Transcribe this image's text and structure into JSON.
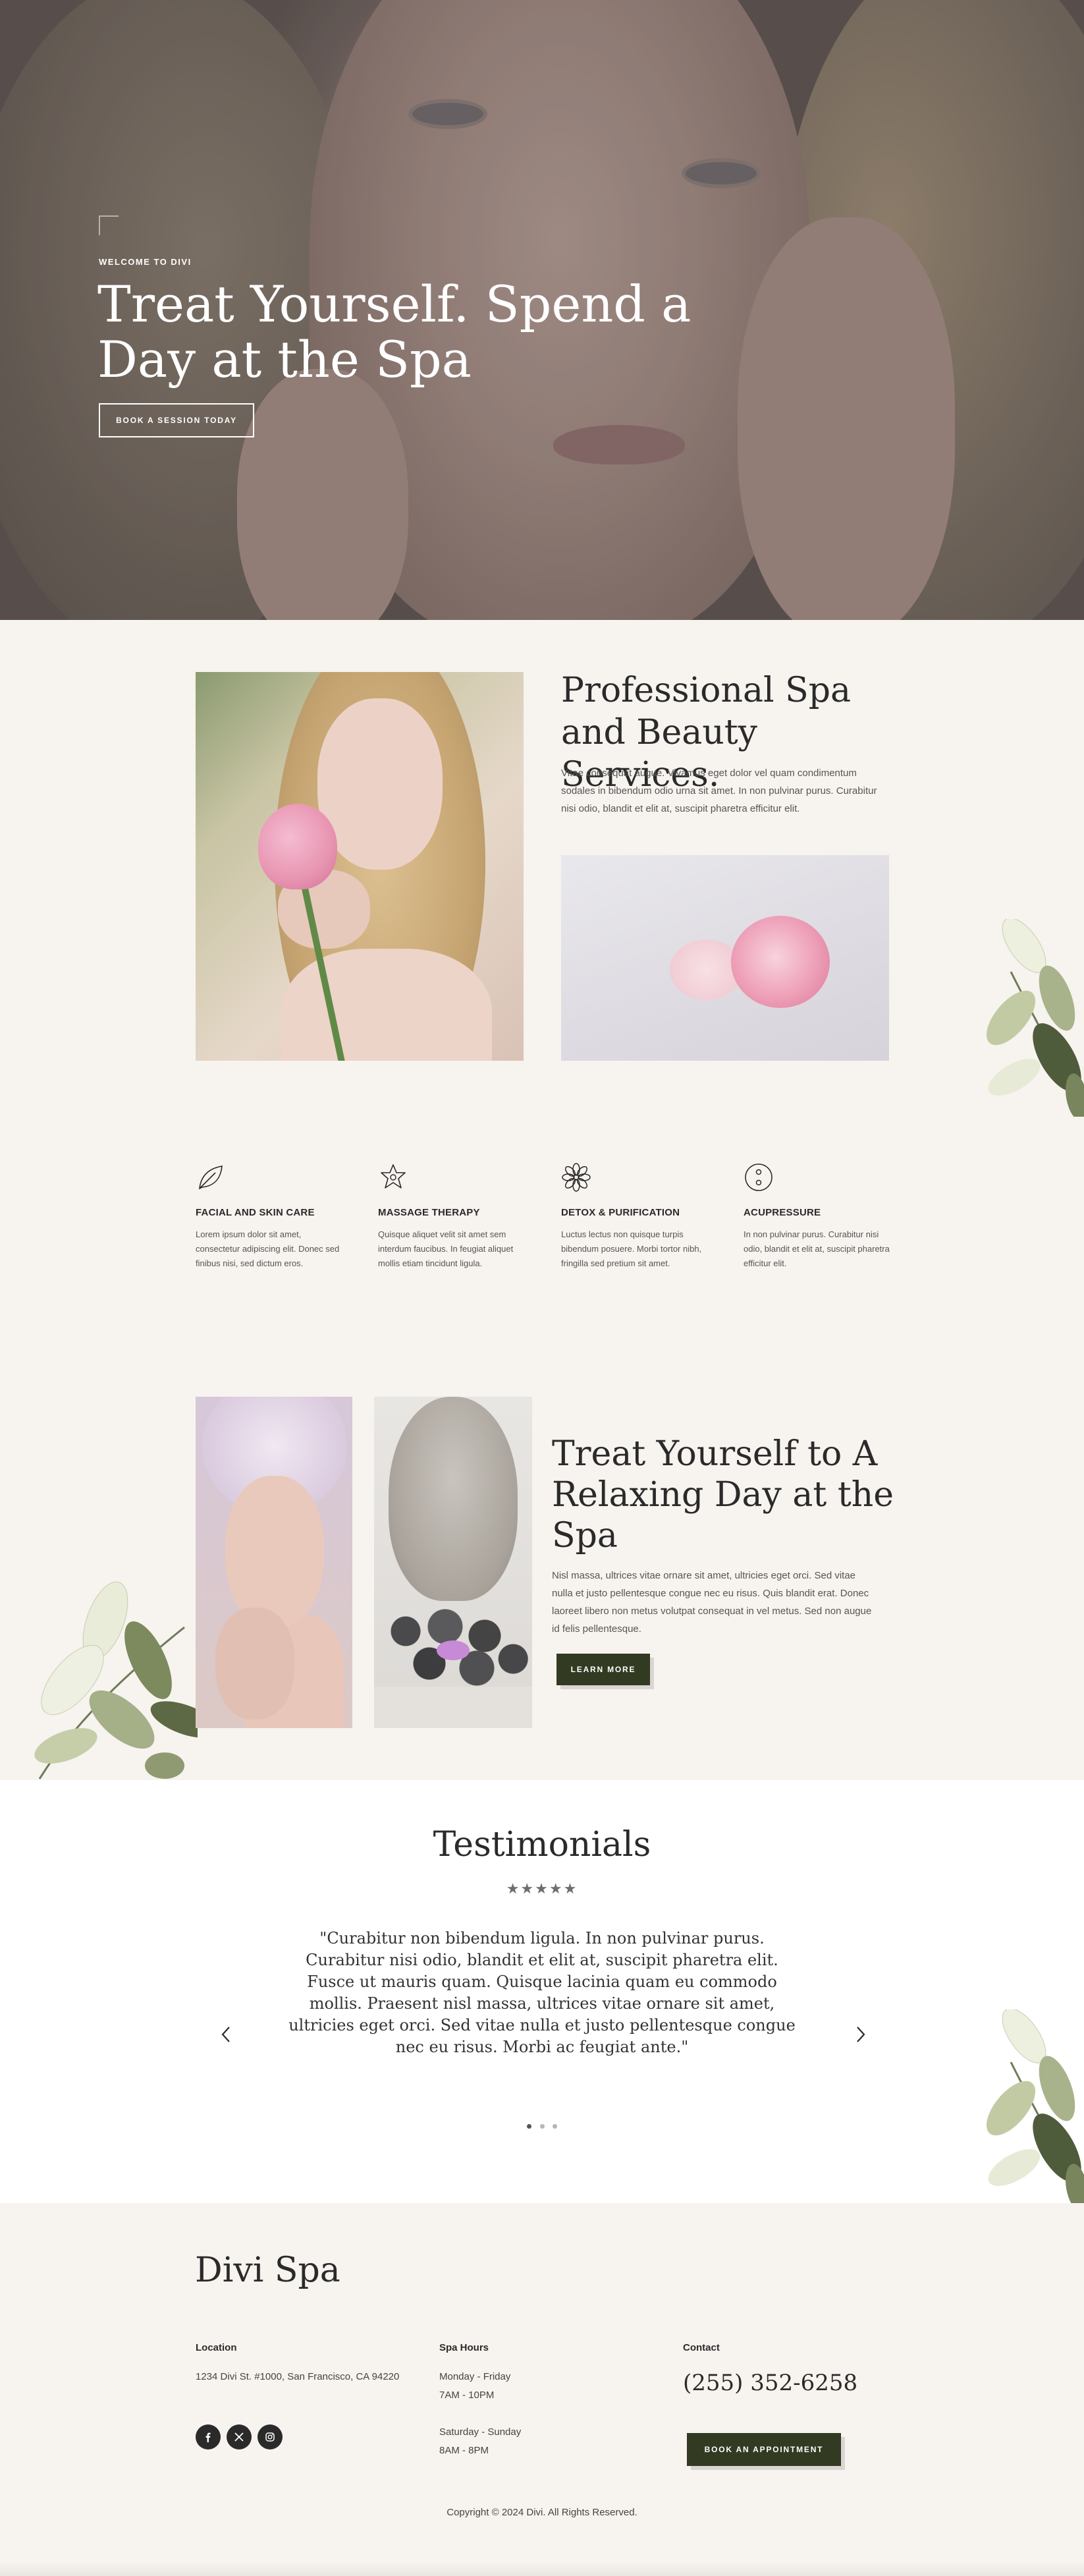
{
  "hero": {
    "kicker": "WELCOME TO DIVI",
    "title": "Treat Yourself. Spend a Day at the Spa",
    "button": "BOOK A SESSION TODAY"
  },
  "about": {
    "title": "Professional Spa and Beauty Services.",
    "text": "Vitae consequat augue. Vivamus eget dolor vel quam condimentum sodales in bibendum odio urna sit amet. In non pulvinar purus. Curabitur nisi odio, blandit et elit at, suscipit pharetra efficitur elit."
  },
  "services": [
    {
      "icon": "leaf-icon",
      "title": "FACIAL AND SKIN CARE",
      "text": "Lorem ipsum dolor sit amet, consectetur adipiscing elit. Donec sed finibus nisi, sed dictum eros."
    },
    {
      "icon": "star-icon",
      "title": "MASSAGE THERAPY",
      "text": "Quisque aliquet velit sit amet sem interdum faucibus. In feugiat aliquet mollis etiam tincidunt ligula."
    },
    {
      "icon": "flower-icon",
      "title": "DETOX & PURIFICATION",
      "text": "Luctus lectus non quisque turpis bibendum posuere. Morbi tortor nibh, fringilla sed pretium sit amet."
    },
    {
      "icon": "acupressure-icon",
      "title": "ACUPRESSURE",
      "text": "In non pulvinar purus. Curabitur nisi odio, blandit et elit at, suscipit pharetra efficitur elit."
    }
  ],
  "relax": {
    "title": "Treat Yourself to A Relaxing Day at the Spa",
    "text": "Nisl massa, ultrices vitae ornare sit amet, ultricies eget orci. Sed vitae nulla et justo pellentesque congue nec eu risus. Quis blandit erat. Donec laoreet libero non metus volutpat consequat in vel metus. Sed non augue id felis pellentesque.",
    "button": "LEARN MORE"
  },
  "testimonials": {
    "title": "Testimonials",
    "stars": "★★★★★",
    "quote": "\"Curabitur non bibendum ligula. In non pulvinar purus. Curabitur nisi odio, blandit et elit at, suscipit pharetra elit. Fusce ut mauris quam. Quisque lacinia quam eu commodo mollis. Praesent nisl massa, ultrices vitae ornare sit amet, ultricies eget orci. Sed vitae nulla et justo pellentesque congue nec eu risus. Morbi ac feugiat ante.\"",
    "slide_count": 3,
    "active_slide": 1
  },
  "footer": {
    "brand": "Divi Spa",
    "location": {
      "heading": "Location",
      "address": "1234 Divi St. #1000, San Francisco, CA 94220"
    },
    "hours": {
      "heading": "Spa Hours",
      "weekday_days": "Monday - Friday",
      "weekday_time": "7AM - 10PM",
      "weekend_days": "Saturday - Sunday",
      "weekend_time": "8AM - 8PM"
    },
    "contact": {
      "heading": "Contact",
      "phone": "(255) 352-6258",
      "button": "BOOK AN APPOINTMENT"
    },
    "social": [
      "facebook-icon",
      "x-icon",
      "instagram-icon"
    ],
    "copyright": "Copyright © 2024 Divi. All Rights Reserved."
  },
  "colors": {
    "background": "#f7f3ef",
    "accent": "#323a22",
    "text": "#2a2a2a"
  }
}
